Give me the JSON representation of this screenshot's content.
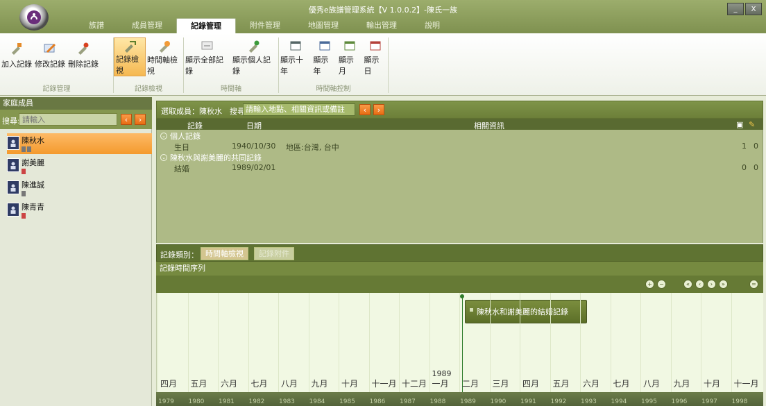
{
  "window": {
    "title": "優秀e族譜管理系統【V 1.0.0.2】-陳氏一族",
    "minimize": "_",
    "close": "X"
  },
  "tabs": [
    "族譜",
    "成員管理",
    "記錄管理",
    "附件管理",
    "地圖管理",
    "輸出管理",
    "說明"
  ],
  "active_tab": 2,
  "ribbon": {
    "groups": [
      {
        "label": "記錄管理",
        "buttons": [
          "加入記錄",
          "修改記錄",
          "刪除記錄"
        ]
      },
      {
        "label": "記錄檢視",
        "buttons": [
          "記錄檢視",
          "時間軸檢視"
        ]
      },
      {
        "label": "時間軸",
        "buttons": [
          "顯示全部記錄",
          "顯示個人記錄"
        ]
      },
      {
        "label": "時間軸控制",
        "buttons": [
          "顯示十年",
          "顯示年",
          "顯示月",
          "顯示日"
        ]
      }
    ]
  },
  "left": {
    "title": "家庭成員",
    "search_label": "搜尋:",
    "search_placeholder": "請輸入",
    "members": [
      {
        "name": "陳秋水",
        "selected": true
      },
      {
        "name": "謝美麗",
        "selected": false
      },
      {
        "name": "陳進誠",
        "selected": false
      },
      {
        "name": "陳青青",
        "selected": false
      }
    ]
  },
  "records": {
    "selected_label": "選取成員：陳秋水",
    "search_label": "搜尋：",
    "search_placeholder": "請輸入地點、相關資訊或備註",
    "columns": [
      "記錄",
      "日期",
      "相關資訊"
    ],
    "groups": [
      {
        "title": "個人記錄",
        "rows": [
          {
            "record": "生日",
            "date": "1940/10/30",
            "info": "地區:台灣, 台中",
            "c1": "1",
            "c2": "0"
          }
        ]
      },
      {
        "title": "陳秋水與謝美麗的共同記錄",
        "rows": [
          {
            "record": "結婚",
            "date": "1989/02/01",
            "info": "",
            "c1": "0",
            "c2": "0"
          }
        ]
      }
    ]
  },
  "timeline": {
    "category_label": "記錄類別：",
    "btn_timeline": "時間軸檢視",
    "btn_attach": "記錄附件",
    "sequence_label": "記錄時間序列",
    "event": "陳秋水和謝美麗的結婚記錄",
    "months": [
      "四月",
      "五月",
      "六月",
      "七月",
      "八月",
      "九月",
      "十月",
      "十一月",
      "十二月",
      "一月",
      "二月",
      "三月",
      "四月",
      "五月",
      "六月",
      "七月",
      "八月",
      "九月",
      "十月",
      "十一月"
    ],
    "year_marker": "1989",
    "years": [
      "1979",
      "1980",
      "1981",
      "1982",
      "1983",
      "1984",
      "1985",
      "1986",
      "1987",
      "1988",
      "1989",
      "1990",
      "1991",
      "1992",
      "1993",
      "1994",
      "1995",
      "1996",
      "1997",
      "1998"
    ]
  }
}
